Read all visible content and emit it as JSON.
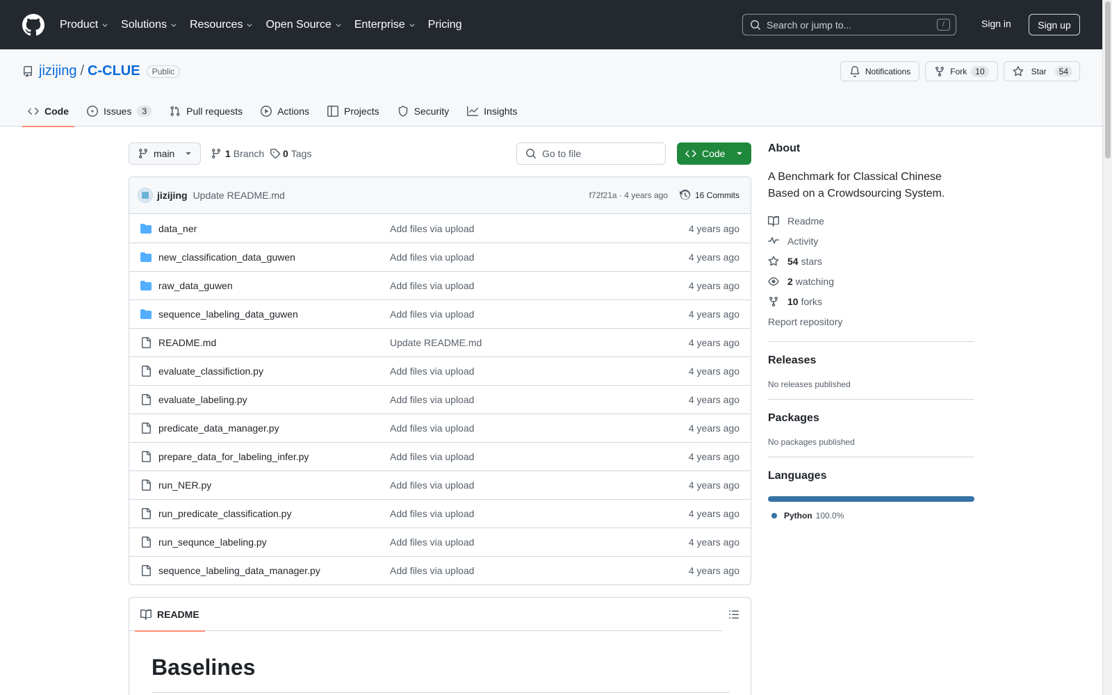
{
  "header": {
    "nav": [
      {
        "label": "Product",
        "dropdown": true
      },
      {
        "label": "Solutions",
        "dropdown": true
      },
      {
        "label": "Resources",
        "dropdown": true
      },
      {
        "label": "Open Source",
        "dropdown": true
      },
      {
        "label": "Enterprise",
        "dropdown": true
      },
      {
        "label": "Pricing",
        "dropdown": false
      }
    ],
    "search_placeholder": "Search or jump to...",
    "search_shortcut": "/",
    "sign_in": "Sign in",
    "sign_up": "Sign up"
  },
  "repo": {
    "owner": "jizijing",
    "separator": "/",
    "name": "C-CLUE",
    "visibility": "Public",
    "notifications_label": "Notifications",
    "fork_label": "Fork",
    "fork_count": "10",
    "star_label": "Star",
    "star_count": "54",
    "tabs": [
      {
        "label": "Code",
        "count": "",
        "icon": "code-icon",
        "active": true
      },
      {
        "label": "Issues",
        "count": "3",
        "icon": "issue-icon",
        "active": false
      },
      {
        "label": "Pull requests",
        "count": "",
        "icon": "pull-request-icon",
        "active": false
      },
      {
        "label": "Actions",
        "count": "",
        "icon": "actions-icon",
        "active": false
      },
      {
        "label": "Projects",
        "count": "",
        "icon": "projects-icon",
        "active": false
      },
      {
        "label": "Security",
        "count": "",
        "icon": "shield-icon",
        "active": false
      },
      {
        "label": "Insights",
        "count": "",
        "icon": "graph-icon",
        "active": false
      }
    ]
  },
  "toolbar": {
    "branch": "main",
    "branch_count": "1",
    "branch_label": "Branch",
    "tag_count": "0",
    "tag_label": "Tags",
    "go_to_file": "Go to file",
    "code_button": "Code"
  },
  "commit": {
    "author": "jizijing",
    "message": "Update README.md",
    "hash_age": "f72f21a · 4 years ago",
    "commits": "16 Commits"
  },
  "files": [
    {
      "name": "data_ner",
      "type": "dir",
      "message": "Add files via upload",
      "age": "4 years ago"
    },
    {
      "name": "new_classification_data_guwen",
      "type": "dir",
      "message": "Add files via upload",
      "age": "4 years ago"
    },
    {
      "name": "raw_data_guwen",
      "type": "dir",
      "message": "Add files via upload",
      "age": "4 years ago"
    },
    {
      "name": "sequence_labeling_data_guwen",
      "type": "dir",
      "message": "Add files via upload",
      "age": "4 years ago"
    },
    {
      "name": "README.md",
      "type": "file",
      "message": "Update README.md",
      "age": "4 years ago"
    },
    {
      "name": "evaluate_classifiction.py",
      "type": "file",
      "message": "Add files via upload",
      "age": "4 years ago"
    },
    {
      "name": "evaluate_labeling.py",
      "type": "file",
      "message": "Add files via upload",
      "age": "4 years ago"
    },
    {
      "name": "predicate_data_manager.py",
      "type": "file",
      "message": "Add files via upload",
      "age": "4 years ago"
    },
    {
      "name": "prepare_data_for_labeling_infer.py",
      "type": "file",
      "message": "Add files via upload",
      "age": "4 years ago"
    },
    {
      "name": "run_NER.py",
      "type": "file",
      "message": "Add files via upload",
      "age": "4 years ago"
    },
    {
      "name": "run_predicate_classification.py",
      "type": "file",
      "message": "Add files via upload",
      "age": "4 years ago"
    },
    {
      "name": "run_sequnce_labeling.py",
      "type": "file",
      "message": "Add files via upload",
      "age": "4 years ago"
    },
    {
      "name": "sequence_labeling_data_manager.py",
      "type": "file",
      "message": "Add files via upload",
      "age": "4 years ago"
    }
  ],
  "readme": {
    "tab_label": "README",
    "heading": "Baselines"
  },
  "sidebar": {
    "about_title": "About",
    "description": "A Benchmark for Classical Chinese Based on a Crowdsourcing System.",
    "links": [
      {
        "icon": "book-icon",
        "bold": "",
        "text": "Readme"
      },
      {
        "icon": "pulse-icon",
        "bold": "",
        "text": "Activity"
      },
      {
        "icon": "star-icon",
        "bold": "54",
        "text": "stars"
      },
      {
        "icon": "eye-icon",
        "bold": "2",
        "text": "watching"
      },
      {
        "icon": "fork-icon",
        "bold": "10",
        "text": "forks"
      }
    ],
    "report": "Report repository",
    "releases_title": "Releases",
    "releases_text": "No releases published",
    "packages_title": "Packages",
    "packages_text": "No packages published",
    "languages_title": "Languages",
    "languages": [
      {
        "name": "Python",
        "percent": "100.0%",
        "color": "#3572a5"
      }
    ]
  },
  "colors": {
    "header_bg": "#24292f",
    "link": "#0969da",
    "primary_button": "#1f883d",
    "active_tab_underline": "#fd8c73",
    "folder_icon": "#54aeff"
  }
}
